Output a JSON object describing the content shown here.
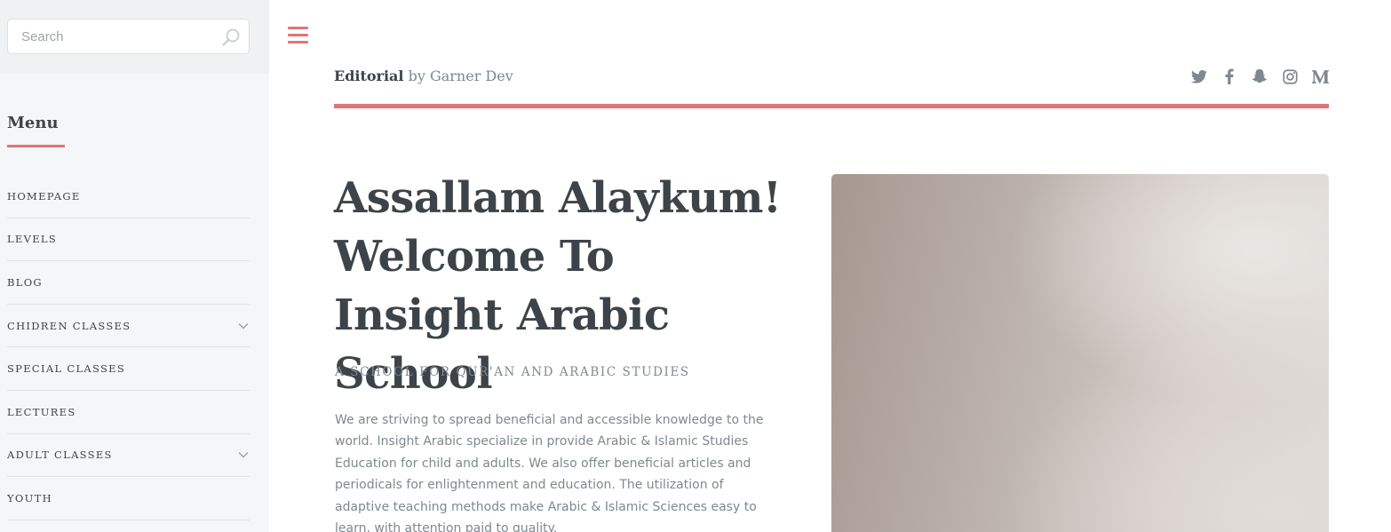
{
  "sidebar": {
    "search": {
      "placeholder": "Search",
      "value": ""
    },
    "menu_title": "Menu",
    "items": [
      {
        "label": "HOMEPAGE",
        "has_submenu": false
      },
      {
        "label": "LEVELS",
        "has_submenu": false
      },
      {
        "label": "BLOG",
        "has_submenu": false
      },
      {
        "label": "CHIDREN CLASSES",
        "has_submenu": true
      },
      {
        "label": "SPECIAL CLASSES",
        "has_submenu": false
      },
      {
        "label": "LECTURES",
        "has_submenu": false
      },
      {
        "label": "ADULT CLASSES",
        "has_submenu": true
      },
      {
        "label": "YOUTH",
        "has_submenu": false
      }
    ]
  },
  "header": {
    "brand_name": "Editorial",
    "brand_by": "by Garner Dev",
    "social_icons": [
      "twitter-icon",
      "facebook-icon",
      "snapchat-icon",
      "instagram-icon",
      "medium-icon"
    ]
  },
  "hero": {
    "title": "Assallam Alaykum! Welcome To Insight Arabic School",
    "subtitle": "A SCHOOL FOR QUR'AN AND ARABIC STUDIES",
    "body": "We are striving to spread beneficial and accessible knowledge to the world. Insight Arabic specialize in provide Arabic & Islamic Studies Education for child and adults. We also offer beneficial articles and periodicals for enlightenment and education. The utilization of adaptive teaching methods make Arabic & Islamic Sciences easy to learn, with attention paid to quality."
  },
  "colors": {
    "accent": "#e07577",
    "text_dark": "#3d4449",
    "text_muted": "#7f888f",
    "sidebar_bg": "#f5f6f7"
  }
}
